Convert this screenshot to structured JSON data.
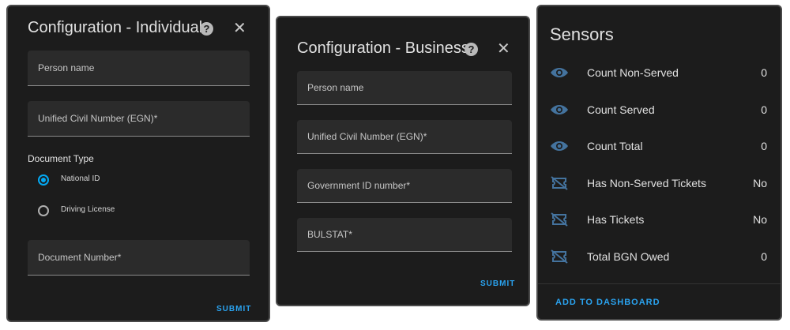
{
  "individual": {
    "title": "Configuration - Individual",
    "help_icon": "?",
    "close_icon": "✕",
    "fields": {
      "person_name": "Person name",
      "egn": "Unified Civil Number (EGN)*",
      "document_number": "Document Number*"
    },
    "document_type": {
      "label": "Document Type",
      "options": [
        {
          "label": "National ID",
          "selected": true
        },
        {
          "label": "Driving License",
          "selected": false
        }
      ]
    },
    "submit": "SUBMIT"
  },
  "business": {
    "title": "Configuration - Business",
    "help_icon": "?",
    "close_icon": "✕",
    "fields": {
      "person_name": "Person name",
      "egn": "Unified Civil Number (EGN)*",
      "gov_id": "Government ID number*",
      "bulstat": "BULSTAT*"
    },
    "submit": "SUBMIT"
  },
  "sensors": {
    "title": "Sensors",
    "items": [
      {
        "icon": "eye-icon",
        "name": "Count Non-Served",
        "value": "0"
      },
      {
        "icon": "eye-icon",
        "name": "Count Served",
        "value": "0"
      },
      {
        "icon": "eye-icon",
        "name": "Count Total",
        "value": "0"
      },
      {
        "icon": "ticket-off-icon",
        "name": "Has Non-Served Tickets",
        "value": "No"
      },
      {
        "icon": "ticket-off-icon",
        "name": "Has Tickets",
        "value": "No"
      },
      {
        "icon": "ticket-off-icon",
        "name": "Total BGN Owed",
        "value": "0"
      }
    ],
    "action": "ADD TO DASHBOARD"
  },
  "colors": {
    "accent": "#03a9f4",
    "icon": "#44739e",
    "card": "#1c1c1c",
    "field": "#2b2b2b"
  }
}
